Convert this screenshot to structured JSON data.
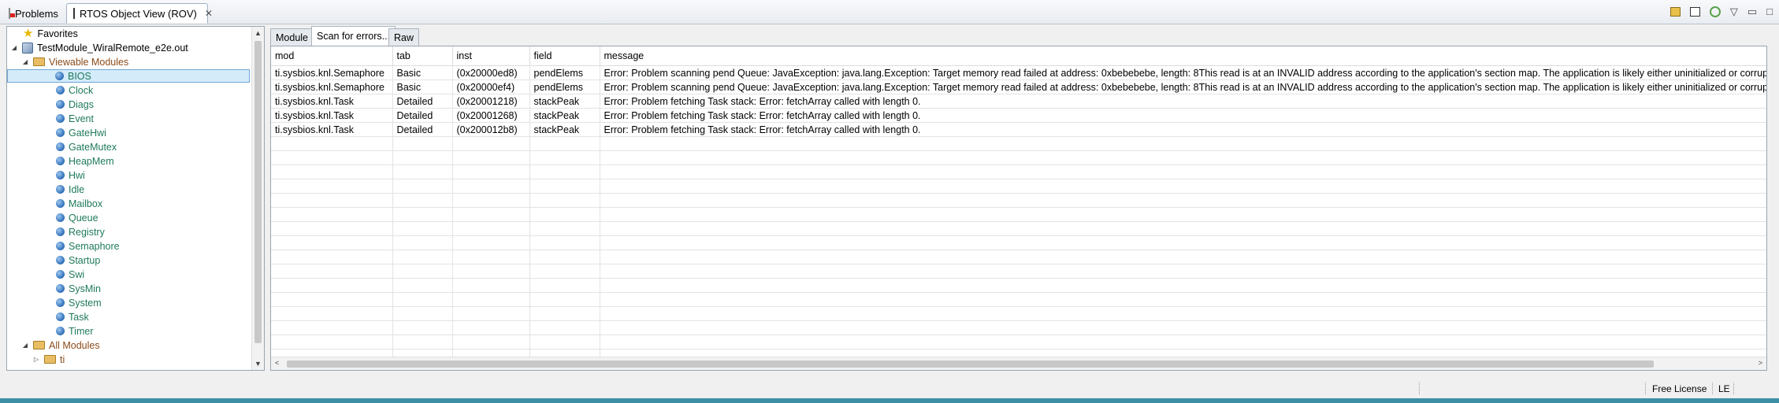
{
  "tabs": {
    "problems": {
      "label": "Problems",
      "icon": "problems-icon"
    },
    "rov": {
      "label": "RTOS Object View (ROV)",
      "icon": "rov-grid-icon",
      "close": "✕"
    }
  },
  "subtabs": [
    {
      "label": "Module",
      "active": false
    },
    {
      "label": "Scan for errors...",
      "active": true
    },
    {
      "label": "Raw",
      "active": false
    }
  ],
  "tree": {
    "favorites": "Favorites",
    "program": "TestModule_WiralRemote_e2e.out",
    "viewable_folder": "Viewable Modules",
    "modules": [
      "BIOS",
      "Clock",
      "Diags",
      "Event",
      "GateHwi",
      "GateMutex",
      "HeapMem",
      "Hwi",
      "Idle",
      "Mailbox",
      "Queue",
      "Registry",
      "Semaphore",
      "Startup",
      "Swi",
      "SysMin",
      "System",
      "Task",
      "Timer"
    ],
    "selected": "BIOS",
    "all_folder": "All Modules",
    "ti_folder": "ti"
  },
  "table": {
    "columns": [
      "mod",
      "tab",
      "inst",
      "field",
      "message"
    ],
    "rows": [
      [
        "ti.sysbios.knl.Semaphore",
        "Basic",
        "(0x20000ed8)",
        "pendElems",
        "Error: Problem scanning pend Queue: JavaException: java.lang.Exception: Target memory read failed at address: 0xbebebebe, length: 8This read is at an INVALID address according to the application's section map. The application is likely either uninitialized or corrupt."
      ],
      [
        "ti.sysbios.knl.Semaphore",
        "Basic",
        "(0x20000ef4)",
        "pendElems",
        "Error: Problem scanning pend Queue: JavaException: java.lang.Exception: Target memory read failed at address: 0xbebebebe, length: 8This read is at an INVALID address according to the application's section map. The application is likely either uninitialized or corrupt."
      ],
      [
        "ti.sysbios.knl.Task",
        "Detailed",
        "(0x20001218)",
        "stackPeak",
        "Error: Problem fetching Task stack: Error: fetchArray called with length 0."
      ],
      [
        "ti.sysbios.knl.Task",
        "Detailed",
        "(0x20001268)",
        "stackPeak",
        "Error: Problem fetching Task stack: Error: fetchArray called with length 0."
      ],
      [
        "ti.sysbios.knl.Task",
        "Detailed",
        "(0x200012b8)",
        "stackPeak",
        "Error: Problem fetching Task stack: Error: fetchArray called with length 0."
      ]
    ],
    "empty_rows": 16
  },
  "status": {
    "license": "Free License",
    "endian": "LE"
  },
  "colors": {
    "module_text": "#1f7a5a",
    "folder_text": "#8a4b1a",
    "selection": "#d4ebfa",
    "bottom_band": "#3d8fa6"
  }
}
